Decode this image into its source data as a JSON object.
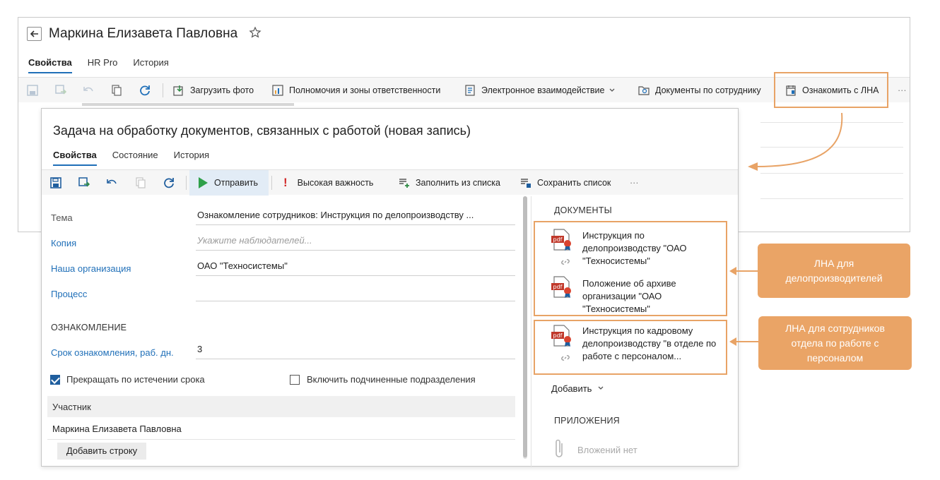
{
  "colors": {
    "accent": "#1f6fb8",
    "highlight": "#e8a366",
    "callout_bg": "#eaa466",
    "send_green": "#2fa04a"
  },
  "employee_card": {
    "title": "Маркина Елизавета Павловна",
    "tabs": [
      "Свойства",
      "HR Pro",
      "История"
    ],
    "toolbar": {
      "upload_photo": "Загрузить фото",
      "authorities": "Полномочия и зоны ответственности",
      "electronic_interaction": "Электронное взаимодействие",
      "employee_docs": "Документы по сотруднику",
      "acquaint_lna": "Ознакомить с ЛНА",
      "more": "···"
    }
  },
  "task": {
    "title": "Задача на обработку документов, связанных с работой (новая запись)",
    "tabs": [
      "Свойства",
      "Состояние",
      "История"
    ],
    "toolbar": {
      "send": "Отправить",
      "high_importance": "Высокая важность",
      "fill_from_list": "Заполнить из списка",
      "save_list": "Сохранить список",
      "more": "···"
    },
    "form": {
      "subject_label": "Тема",
      "subject_value": "Ознакомление сотрудников: Инструкция по делопроизводству ...",
      "copy_label": "Копия",
      "copy_placeholder": "Укажите наблюдателей...",
      "org_label": "Наша организация",
      "org_value": "ОАО \"Техносистемы\"",
      "process_label": "Процесс",
      "process_value": ""
    },
    "acquaintance": {
      "section_title": "ОЗНАКОМЛЕНИЕ",
      "deadline_label": "Срок ознакомления, раб. дн.",
      "deadline_value": "3",
      "stop_on_expiry_label": "Прекращать по истечении срока",
      "stop_on_expiry_checked": true,
      "include_subdivisions_label": "Включить подчиненные подразделения",
      "include_subdivisions_checked": false
    },
    "participants": {
      "column_header": "Участник",
      "rows": [
        "Маркина Елизавета Павловна"
      ],
      "add_row_label": "Добавить строку"
    },
    "documents": {
      "section_title": "ДОКУМЕНТЫ",
      "group1": [
        "Инструкция по делопроизводству \"ОАО \"Техносистемы\"",
        "Положение об архиве организации \"ОАО \"Техносистемы\""
      ],
      "group2": [
        "Инструкция по кадровому делопроизводству \"в отделе по работе с персоналом..."
      ],
      "add_label": "Добавить",
      "attachments_title": "ПРИЛОЖЕНИЯ",
      "no_attachments": "Вложений нет",
      "pdf_badge": "pdf"
    }
  },
  "callouts": {
    "clerks": "ЛНА для делопроизводителей",
    "hr_staff": "ЛНА для сотрудников отдела по работе с персоналом"
  }
}
